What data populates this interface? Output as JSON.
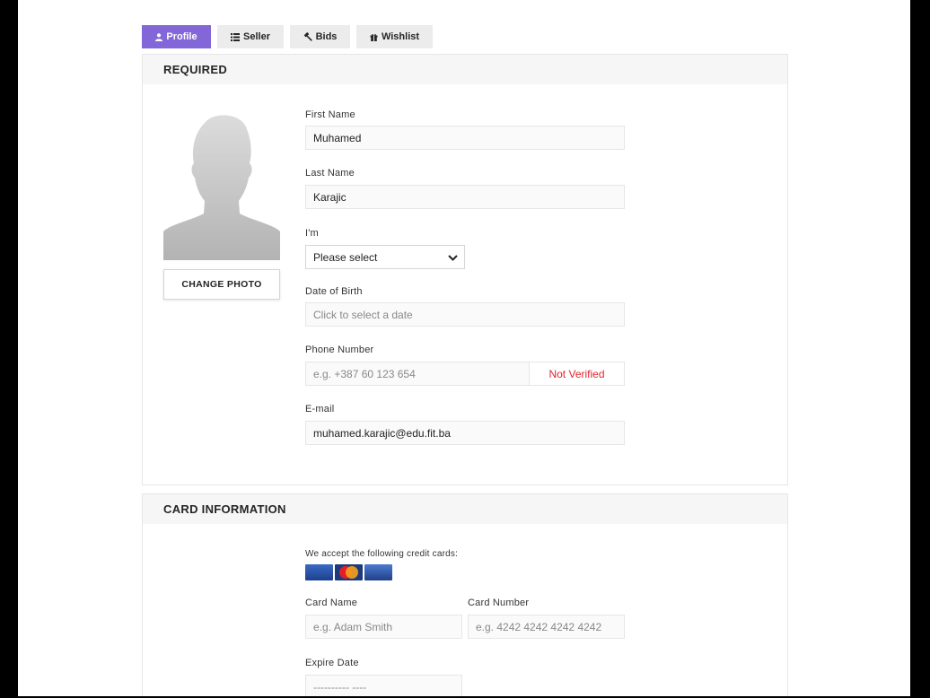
{
  "tabs": [
    {
      "label": "Profile",
      "icon": "user-icon",
      "active": true
    },
    {
      "label": "Seller",
      "icon": "list-icon",
      "active": false
    },
    {
      "label": "Bids",
      "icon": "gavel-icon",
      "active": false
    },
    {
      "label": "Wishlist",
      "icon": "gift-icon",
      "active": false
    }
  ],
  "required": {
    "title": "REQUIRED",
    "change_photo_label": "CHANGE PHOTO",
    "first_name": {
      "label": "First Name",
      "value": "Muhamed"
    },
    "last_name": {
      "label": "Last Name",
      "value": "Karajic"
    },
    "gender": {
      "label": "I'm",
      "value": "Please select"
    },
    "dob": {
      "label": "Date of Birth",
      "placeholder": "Click to select a date"
    },
    "phone": {
      "label": "Phone Number",
      "placeholder": "e.g. +387 60 123 654",
      "status": "Not Verified"
    },
    "email": {
      "label": "E-mail",
      "value": "muhamed.karajic@edu.fit.ba"
    }
  },
  "card_info": {
    "title": "CARD INFORMATION",
    "accept_text": "We accept the following credit cards:",
    "cards": [
      "visa-card-icon",
      "mastercard-icon",
      "visa-card-icon"
    ],
    "card_name": {
      "label": "Card Name",
      "placeholder": "e.g. Adam Smith"
    },
    "card_number": {
      "label": "Card Number",
      "placeholder": "e.g. 4242 4242 4242 4242"
    },
    "expire_date": {
      "label": "Expire Date",
      "value": "---------- ----"
    }
  },
  "colors": {
    "accent": "#8367d8",
    "error": "#e0242d",
    "panel_header": "#f6f6f6"
  }
}
